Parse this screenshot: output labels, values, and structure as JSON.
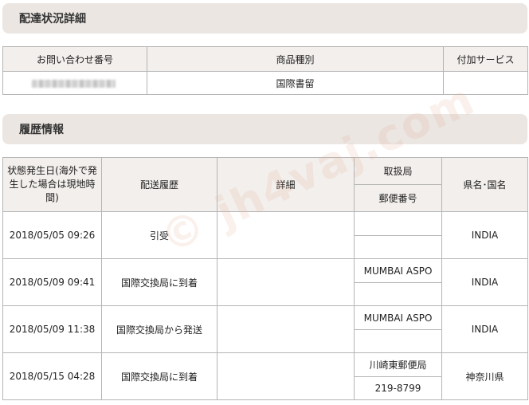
{
  "section1": {
    "title": "配達状況詳細"
  },
  "summary": {
    "headers": [
      "お問い合わせ番号",
      "商品種別",
      "付加サービス"
    ],
    "row": {
      "inquiry_number_redacted": true,
      "product_type": "国際書留",
      "additional_service": ""
    }
  },
  "section2": {
    "title": "履歴情報"
  },
  "history": {
    "headers": {
      "date": "状態発生日(海外で発生した場合は現地時間)",
      "history": "配送履歴",
      "detail": "詳細",
      "office": "取扱局",
      "postal": "郵便番号",
      "region": "県名･国名"
    },
    "rows": [
      {
        "date": "2018/05/05 09:26",
        "history": "引受",
        "detail": "",
        "office": "",
        "postal": "",
        "region": "INDIA"
      },
      {
        "date": "2018/05/09 09:41",
        "history": "国際交換局に到着",
        "detail": "",
        "office": "MUMBAI ASPO",
        "postal": "",
        "region": "INDIA"
      },
      {
        "date": "2018/05/09 11:38",
        "history": "国際交換局から発送",
        "detail": "",
        "office": "MUMBAI ASPO",
        "postal": "",
        "region": "INDIA"
      },
      {
        "date": "2018/05/15 04:28",
        "history": "国際交換局に到着",
        "detail": "",
        "office": "川崎東郵便局",
        "postal": "219-8799",
        "region": "神奈川県"
      }
    ]
  },
  "watermark": "© jh4vaj.com"
}
